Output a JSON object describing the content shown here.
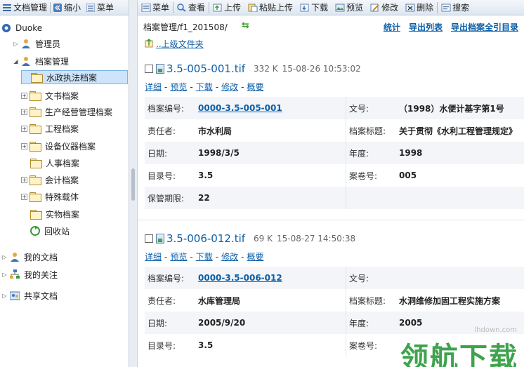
{
  "left_toolbar": {
    "manage_label": "文档管理",
    "collapse_label": "缩小",
    "menu_label": "菜单"
  },
  "tree": {
    "root": "Duoke",
    "admin": "管理员",
    "archive": "档案管理",
    "folders": [
      "水政执法档案",
      "文书档案",
      "生产经营管理档案",
      "工程档案",
      "设备仪器档案",
      "人事档案",
      "会计档案",
      "特殊载体",
      "实物档案"
    ],
    "recycle": "回收站",
    "my_docs": "我的文档",
    "my_follow": "我的关注",
    "shared_docs": "共享文档"
  },
  "right_toolbar": {
    "items": [
      "菜单",
      "查看",
      "上传",
      "粘贴上传",
      "下载",
      "预览",
      "修改",
      "删除",
      "搜索"
    ]
  },
  "content": {
    "path": "档案管理/f1_201508/",
    "actions": [
      "统计",
      "导出列表",
      "导出档案全引目录"
    ],
    "up_link": "..上级文件夹",
    "link_labels": [
      "详细",
      "预览",
      "下载",
      "修改",
      "概要"
    ],
    "field_labels": {
      "archive_no": "档案编号:",
      "doc_no": "文号:",
      "responsible": "责任者:",
      "title": "档案标题:",
      "date": "日期:",
      "year": "年度:",
      "catalog_no": "目录号:",
      "volume_no": "案卷号:",
      "retention": "保管期限:"
    },
    "files": [
      {
        "name": "3.5-005-001.tif",
        "size": "332 K",
        "time": "15-08-26 10:53:02",
        "archive_no": "0000-3.5-005-001",
        "doc_no": "（1998）水便计基字第1号",
        "responsible": "市水利局",
        "title": "关于贯彻《水利工程管理规定》",
        "date": "1998/3/5",
        "year": "1998",
        "catalog_no": "3.5",
        "volume_no": "005",
        "retention": "22"
      },
      {
        "name": "3.5-006-012.tif",
        "size": "69 K",
        "time": "15-08-27 14:50:38",
        "archive_no": "0000-3.5-006-012",
        "doc_no": "",
        "responsible": "水库管理局",
        "title": "水洞维修加固工程实施方案",
        "date": "2005/9/20",
        "year": "2005",
        "catalog_no": "3.5",
        "volume_no": "",
        "retention": ""
      }
    ]
  },
  "watermark": {
    "site": "lhdown.com",
    "brand": "领航下载"
  }
}
